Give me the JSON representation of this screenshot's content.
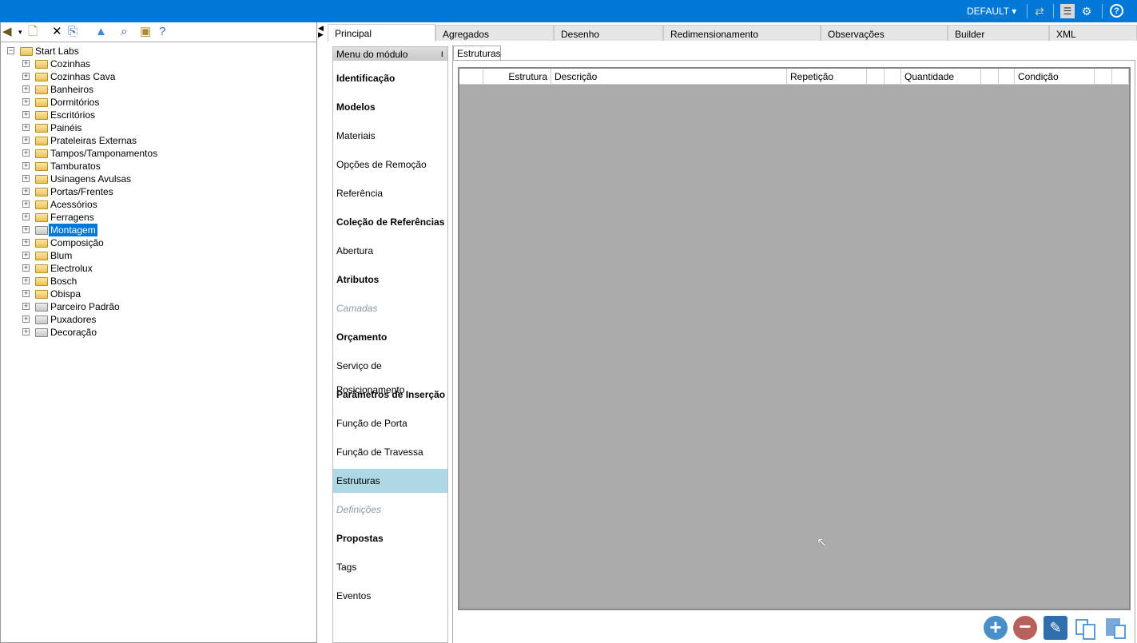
{
  "header": {
    "profile": "DEFAULT",
    "icons": [
      "sync-icon",
      "layout-icon",
      "settings-icon",
      "help-icon"
    ]
  },
  "toolbar": {
    "icons": [
      "back-icon",
      "new-item-icon",
      "delete-icon",
      "copy-icon",
      "move-up-icon",
      "find-icon",
      "folder-export-icon",
      "tree-help-icon"
    ]
  },
  "tree": {
    "root": "Start Labs",
    "items": [
      {
        "label": "Cozinhas",
        "gray": false
      },
      {
        "label": "Cozinhas Cava",
        "gray": false
      },
      {
        "label": "Banheiros",
        "gray": false
      },
      {
        "label": "Dormitórios",
        "gray": false
      },
      {
        "label": "Escritórios",
        "gray": false
      },
      {
        "label": "Painéis",
        "gray": false
      },
      {
        "label": "Prateleiras Externas",
        "gray": false
      },
      {
        "label": "Tampos/Tamponamentos",
        "gray": false
      },
      {
        "label": "Tamburatos",
        "gray": false
      },
      {
        "label": "Usinagens Avulsas",
        "gray": false
      },
      {
        "label": "Portas/Frentes",
        "gray": false
      },
      {
        "label": "Acessórios",
        "gray": false
      },
      {
        "label": "Ferragens",
        "gray": false
      },
      {
        "label": "Montagem",
        "gray": true,
        "selected": true
      },
      {
        "label": "Composição",
        "gray": false
      },
      {
        "label": "Blum",
        "gray": false
      },
      {
        "label": "Electrolux",
        "gray": false
      },
      {
        "label": "Bosch",
        "gray": false
      },
      {
        "label": "Obispa",
        "gray": false
      },
      {
        "label": "Parceiro Padrão",
        "gray": true
      },
      {
        "label": "Puxadores",
        "gray": true
      },
      {
        "label": "Decoração",
        "gray": true
      }
    ]
  },
  "tabs": [
    "Principal",
    "Agregados",
    "Desenho",
    "Redimensionamento",
    "Observações",
    "Builder",
    "XML"
  ],
  "menu": {
    "title": "Menu do módulo",
    "items": [
      {
        "label": "Identificação",
        "style": "b"
      },
      {
        "label": "Modelos",
        "style": "b"
      },
      {
        "label": "Materiais",
        "style": ""
      },
      {
        "label": "Opções de Remoção",
        "style": ""
      },
      {
        "label": "Referência",
        "style": ""
      },
      {
        "label": "Coleção de Referências",
        "style": "b"
      },
      {
        "label": "Abertura",
        "style": ""
      },
      {
        "label": "Atributos",
        "style": "b"
      },
      {
        "label": "Camadas",
        "style": "d"
      },
      {
        "label": "Orçamento",
        "style": "b"
      },
      {
        "label": "Serviço de Posicionamento",
        "style": ""
      },
      {
        "label": "Parâmetros de Inserção",
        "style": "b"
      },
      {
        "label": "Função de Porta",
        "style": ""
      },
      {
        "label": "Função de Travessa",
        "style": ""
      },
      {
        "label": "Estruturas",
        "style": "sel"
      },
      {
        "label": "Definições",
        "style": "d"
      },
      {
        "label": "Propostas",
        "style": "b"
      },
      {
        "label": "Tags",
        "style": ""
      },
      {
        "label": "Eventos",
        "style": ""
      }
    ]
  },
  "subtab": "Estruturas",
  "grid": {
    "columns": [
      "Estrutura",
      "Descrição",
      "Repetição",
      "",
      "",
      "Quantidade",
      "",
      "",
      "Condição",
      "",
      ""
    ]
  },
  "actions": [
    "add-icon",
    "remove-icon",
    "edit-icon",
    "duplicate-icon",
    "paste-icon"
  ]
}
